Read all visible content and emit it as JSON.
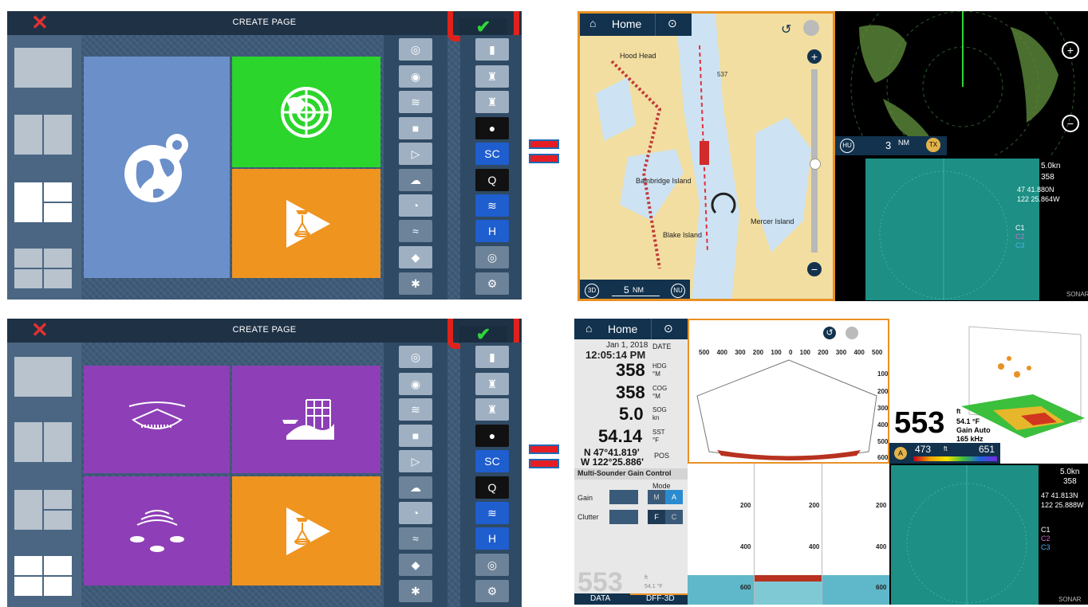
{
  "create_page": {
    "title": "CREATE PAGE",
    "close_icon": "✕",
    "confirm_icon": "✔"
  },
  "top_map": {
    "home_label": "Home",
    "scale_label": "5",
    "scale_unit": "NM",
    "view_3d": "3D",
    "north_up": "NU",
    "places": [
      "Hood Head",
      "Bainbridge Island",
      "Blake Island",
      "Mercer Island"
    ],
    "depth_mark": "537"
  },
  "top_radar": {
    "mode": "HU",
    "range": "3",
    "range_unit": "NM",
    "tx": "TX"
  },
  "top_sonar": {
    "speed": "5.0kn",
    "heading": "358",
    "lat": "47 41.880N",
    "lon": "122 25.864W",
    "label": "SONAR",
    "rows": [
      "C1",
      "C2",
      "C3"
    ]
  },
  "bottom_data": {
    "home_label": "Home",
    "date": "Jan 1, 2018",
    "time": "12:05:14 PM",
    "date_label": "DATE",
    "hdg_value": "358",
    "hdg_label": "HDG",
    "hdg_unit": "°M",
    "cog_value": "358",
    "cog_label": "COG",
    "cog_unit": "°M",
    "sog_value": "5.0",
    "sog_label": "SOG",
    "sog_unit": "kn",
    "sst_value": "54.14",
    "sst_label": "SST",
    "sst_unit": "°F",
    "pos_lat": "N 47°41.819'",
    "pos_lon": "W 122°25.886'",
    "pos_label": "POS",
    "gain_title": "Multi-Sounder Gain Control",
    "mode_label": "Mode",
    "gain_label": "Gain",
    "clutter_label": "Clutter",
    "gain_m": "M",
    "gain_a": "A",
    "clutter_f": "F",
    "clutter_c": "C",
    "depth_big": "553",
    "depth_unit": "ft",
    "temp_small": "54.1 °F",
    "tab_data": "DATA",
    "tab_dff": "DFF-3D"
  },
  "bottom_sounder": {
    "scale": [
      "500",
      "400",
      "300",
      "200",
      "100",
      "0",
      "100",
      "200",
      "300",
      "400",
      "500"
    ],
    "depths": [
      "100",
      "200",
      "300",
      "400",
      "500",
      "600"
    ],
    "lower_depths": [
      "200",
      "400",
      "600"
    ]
  },
  "bottom_3d": {
    "depth": "553",
    "depth_unit": "ft",
    "temp": "54.1 °F",
    "gain": "Gain Auto",
    "freq": "165 kHz",
    "mode": "A",
    "scale_min": "473",
    "scale_unit": "ft",
    "scale_max": "651"
  },
  "bottom_sonar": {
    "speed": "5.0kn",
    "heading": "358",
    "lat": "47 41.813N",
    "lon": "122 25.888W",
    "label": "SONAR",
    "rows": [
      "C1",
      "C2",
      "C3"
    ]
  },
  "colors": {
    "nav_blue": "#12324e",
    "accent_orange": "#e89124",
    "globe_blue": "#6b8fc9",
    "radar_green": "#2ed62e",
    "sonar_purple": "#8e3fb7"
  }
}
